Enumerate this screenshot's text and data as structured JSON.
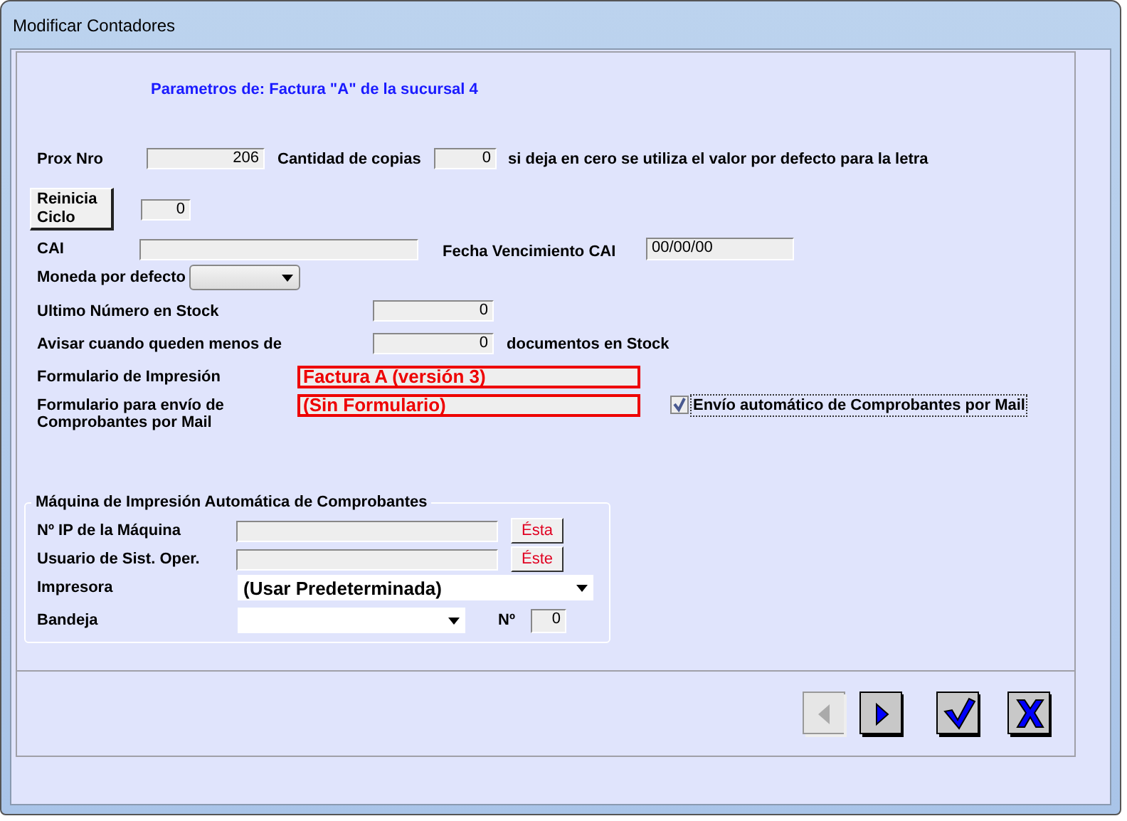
{
  "window": {
    "title": "Modificar Contadores"
  },
  "heading": "Parametros de: Factura \"A\" de la sucursal 4",
  "prox_nro": {
    "label": "Prox Nro",
    "value": "206"
  },
  "copias": {
    "label": "Cantidad de copias",
    "value": "0",
    "hint": "si deja en cero se utiliza el valor por defecto para la letra"
  },
  "reinicia": {
    "label": "Reinicia Ciclo",
    "value": "0"
  },
  "cai": {
    "label": "CAI"
  },
  "fecha_cai": {
    "label": "Fecha Vencimiento CAI",
    "value": "00/00/00"
  },
  "moneda": {
    "label": "Moneda por defecto"
  },
  "ultimo": {
    "label": "Ultimo Número en Stock",
    "value": "0"
  },
  "avisar": {
    "label": "Avisar cuando queden menos de",
    "value": "0",
    "suffix": "documentos en Stock"
  },
  "formulario_impresion": {
    "label": "Formulario de Impresión",
    "value": "Factura A (versión 3)"
  },
  "formulario_mail": {
    "label": "Formulario para envío de Comprobantes por Mail",
    "value": "(Sin Formulario)"
  },
  "envio_auto": {
    "label": "Envío automático de Comprobantes por Mail",
    "checked": true
  },
  "maquina": {
    "title": "Máquina de Impresión Automática de Comprobantes",
    "ip": {
      "label": "Nº IP de la Máquina",
      "button": "Ésta"
    },
    "usuario": {
      "label": "Usuario de Sist. Oper.",
      "button": "Éste"
    },
    "impresora": {
      "label": "Impresora",
      "value": "(Usar Predeterminada)"
    },
    "bandeja": {
      "label": "Bandeja",
      "num_label": "Nº",
      "num_value": "0"
    }
  },
  "nav_buttons": [
    {
      "kind": "prev",
      "disabled": true
    },
    {
      "kind": "next",
      "disabled": false
    },
    {
      "kind": "ok",
      "disabled": false
    },
    {
      "kind": "cancel",
      "disabled": false
    }
  ]
}
